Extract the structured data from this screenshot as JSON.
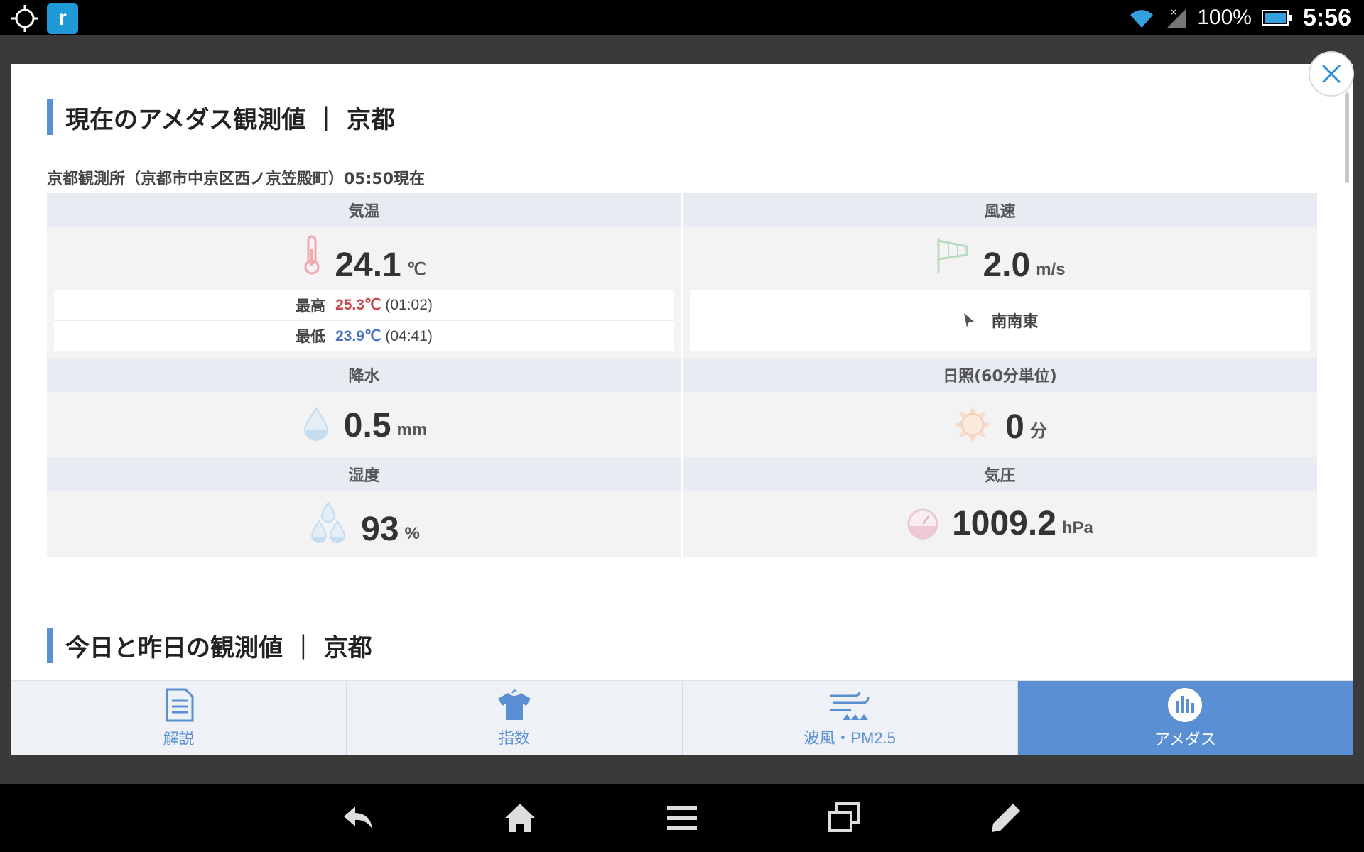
{
  "status_bar": {
    "app_icon_letter": "r",
    "battery_percent": "100%",
    "time": "5:56"
  },
  "section1": {
    "title": "現在のアメダス観測値 ｜ 京都",
    "subtitle": "京都観測所（京都市中京区西ノ京笠殿町）05:50現在"
  },
  "temperature": {
    "header": "気温",
    "value": "24.1",
    "unit": "℃",
    "max_label": "最高",
    "max_value": "25.3℃",
    "max_time": "(01:02)",
    "min_label": "最低",
    "min_value": "23.9℃",
    "min_time": "(04:41)"
  },
  "wind": {
    "header": "風速",
    "value": "2.0",
    "unit": "m/s",
    "direction": "南南東"
  },
  "precipitation": {
    "header": "降水",
    "value": "0.5",
    "unit": "mm"
  },
  "sunshine": {
    "header": "日照(60分単位)",
    "value": "0",
    "unit": "分"
  },
  "humidity": {
    "header": "湿度",
    "value": "93",
    "unit": "%"
  },
  "pressure": {
    "header": "気圧",
    "value": "1009.2",
    "unit": "hPa"
  },
  "section2": {
    "title": "今日と昨日の観測値 ｜ 京都"
  },
  "bottom_nav": {
    "items": [
      {
        "label": "解説",
        "icon": "document-icon"
      },
      {
        "label": "指数",
        "icon": "shirt-icon"
      },
      {
        "label": "波風・PM2.5",
        "icon": "wind-wave-icon"
      },
      {
        "label": "アメダス",
        "icon": "bar-chart-icon",
        "active": true
      }
    ]
  },
  "colors": {
    "accent": "#5b8fd4",
    "max_temp": "#c9454b",
    "min_temp": "#4a74c2",
    "header_bg": "#e7ecf2"
  }
}
